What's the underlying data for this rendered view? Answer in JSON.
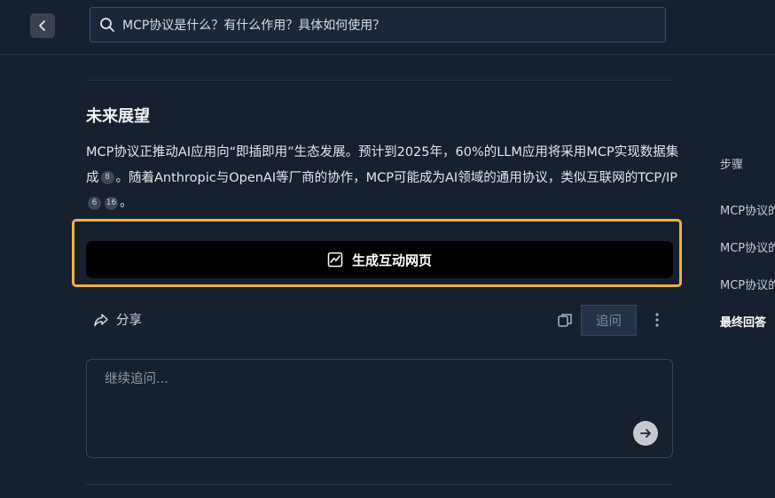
{
  "header": {
    "search_query": "MCP协议是什么？有什么作用？具体如何使用？"
  },
  "section": {
    "title": "未来展望",
    "para_1a": "MCP协议正推动AI应用向“即插即用”生态发展。预计到2025年，60%的LLM应用将采用MCP实现数据集成",
    "cite_8": "8",
    "para_1b": "。随着Anthropic与OpenAI等厂商的协作，MCP可能成为AI领域的通用协议，类似互联网的TCP/IP",
    "cite_6": "6",
    "cite_16": "16",
    "para_1c": "。"
  },
  "actions": {
    "generate_label": "生成互动网页",
    "share_label": "分享",
    "followup_label": "追问"
  },
  "input": {
    "placeholder": "继续追问..."
  },
  "toc": {
    "title": "步骤",
    "items": [
      {
        "label": "MCP协议的"
      },
      {
        "label": "MCP协议的"
      },
      {
        "label": "MCP协议的"
      },
      {
        "label": "最终回答"
      }
    ]
  },
  "colors": {
    "background": "#16202e",
    "highlight_border": "#f3b13a",
    "button_bg": "#000000"
  }
}
